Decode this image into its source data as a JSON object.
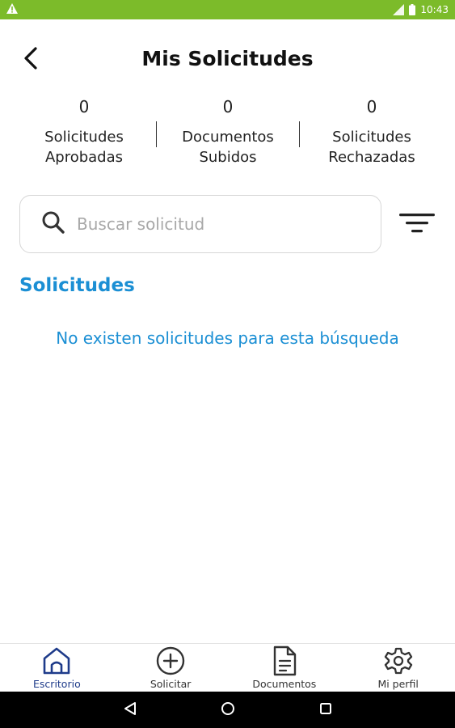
{
  "status_bar": {
    "time": "10:43",
    "background": "#7cbb2a",
    "icons": [
      "warning-icon",
      "signal-icon",
      "battery-icon"
    ]
  },
  "header": {
    "title": "Mis Solicitudes",
    "back_icon": "chevron-left-icon"
  },
  "stats": [
    {
      "count": "0",
      "line1": "Solicitudes",
      "line2": "Aprobadas"
    },
    {
      "count": "0",
      "line1": "Documentos",
      "line2": "Subidos"
    },
    {
      "count": "0",
      "line1": "Solicitudes",
      "line2": "Rechazadas"
    }
  ],
  "search": {
    "placeholder": "Buscar solicitud",
    "value": "",
    "icon": "search-icon"
  },
  "filter": {
    "icon": "filter-icon"
  },
  "section": {
    "title": "Solicitudes",
    "empty_message": "No existen solicitudes para esta búsqueda"
  },
  "bottom_nav": {
    "items": [
      {
        "label": "Escritorio",
        "icon": "home-icon",
        "active": true
      },
      {
        "label": "Solicitar",
        "icon": "plus-circle-icon",
        "active": false
      },
      {
        "label": "Documentos",
        "icon": "document-icon",
        "active": false
      },
      {
        "label": "Mi perfil",
        "icon": "gear-icon",
        "active": false
      }
    ]
  },
  "colors": {
    "accent": "#1b8fd4",
    "nav_active": "#1e3b8a",
    "status_bar": "#7cbb2a"
  }
}
